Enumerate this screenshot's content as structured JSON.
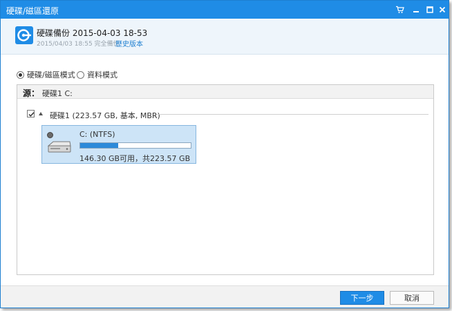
{
  "window": {
    "title": "硬碟/磁區還原"
  },
  "header": {
    "title": "硬碟備份 2015-04-03 18-53",
    "subtitle": "2015/04/03 18:55 完全備份",
    "history_link": "歷史版本"
  },
  "modes": [
    {
      "label": "硬碟/磁區模式",
      "selected": true
    },
    {
      "label": "資料模式",
      "selected": false
    }
  ],
  "source": {
    "label": "源：",
    "value": "硬碟1 C:"
  },
  "disk": {
    "checked": true,
    "label": "硬碟1 (223.57 GB, 基本, MBR)"
  },
  "partition": {
    "name": "C: (NTFS)",
    "used_fraction": 0.345,
    "free_text": "146.30 GB可用，共223.57 GB"
  },
  "buttons": {
    "next": "下一步",
    "cancel": "取消"
  },
  "colors": {
    "accent": "#1f8ce6",
    "selection": "#cde4f7"
  },
  "icons": [
    "cart-icon",
    "minimize-icon",
    "maximize-icon",
    "close-icon",
    "app-icon",
    "hard-drive-icon"
  ]
}
